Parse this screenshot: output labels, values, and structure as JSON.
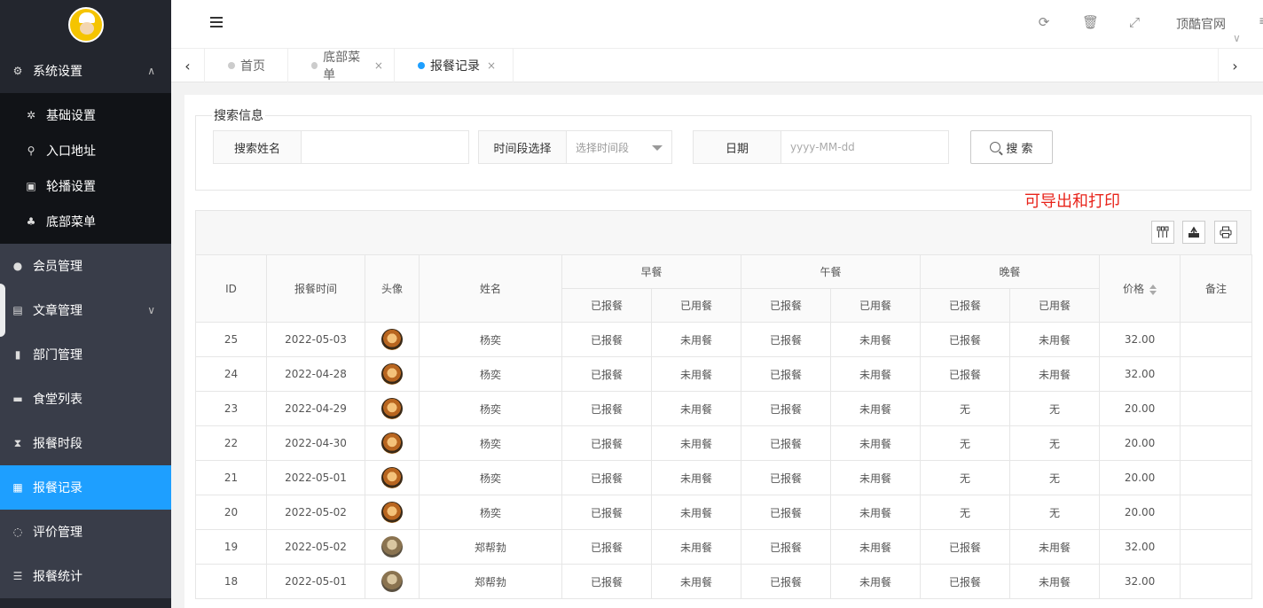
{
  "sidebar": {
    "groups": [
      {
        "label": "系统设置",
        "icon": "gears-icon",
        "arrow": "∧"
      },
      {
        "label": "会员管理",
        "icon": "user-icon"
      },
      {
        "label": "文章管理",
        "icon": "article-icon",
        "arrow": "∨"
      },
      {
        "label": "部门管理",
        "icon": "department-icon"
      },
      {
        "label": "食堂列表",
        "icon": "canteen-icon"
      },
      {
        "label": "报餐时段",
        "icon": "hourglass-icon"
      },
      {
        "label": "报餐记录",
        "icon": "table-icon"
      },
      {
        "label": "评价管理",
        "icon": "comment-icon"
      },
      {
        "label": "报餐统计",
        "icon": "stats-icon"
      }
    ],
    "sub_items": [
      {
        "label": "基础设置",
        "icon": "gear-icon"
      },
      {
        "label": "入口地址",
        "icon": "search-icon"
      },
      {
        "label": "轮播设置",
        "icon": "image-icon"
      },
      {
        "label": "底部菜单",
        "icon": "sitemap-icon"
      }
    ]
  },
  "header": {
    "link": "顶酷官网",
    "caret": "∨",
    "more": "≡",
    "icons": [
      "refresh-icon",
      "trash-icon",
      "fullscreen-icon"
    ]
  },
  "tabs": [
    {
      "label": "首页",
      "closable": false
    },
    {
      "label": "底部菜单",
      "closable": true
    },
    {
      "label": "报餐记录",
      "closable": true,
      "active": true
    }
  ],
  "tab_close": "×",
  "tab_prev": "‹",
  "tab_next": "›",
  "search": {
    "legend": "搜索信息",
    "name_label": "搜索姓名",
    "name_value": "",
    "period_label": "时间段选择",
    "period_placeholder": "选择时间段",
    "date_label": "日期",
    "date_placeholder": "yyyy-MM-dd",
    "button": "搜 索"
  },
  "annotation": "可导出和打印",
  "toolbar_icons": [
    "columns-icon",
    "export-icon",
    "print-icon"
  ],
  "table": {
    "headers": {
      "id": "ID",
      "time": "报餐时间",
      "avatar": "头像",
      "name": "姓名",
      "breakfast": "早餐",
      "lunch": "午餐",
      "dinner": "晚餐",
      "reported": "已报餐",
      "used": "已用餐",
      "price": "价格",
      "remark": "备注"
    },
    "rows": [
      {
        "id": "25",
        "time": "2022-05-03",
        "avatar": "tiger",
        "name": "杨奕",
        "b1": "已报餐",
        "b2": "未用餐",
        "l1": "已报餐",
        "l2": "未用餐",
        "d1": "已报餐",
        "d2": "未用餐",
        "price": "32.00",
        "remark": ""
      },
      {
        "id": "24",
        "time": "2022-04-28",
        "avatar": "tiger",
        "name": "杨奕",
        "b1": "已报餐",
        "b2": "未用餐",
        "l1": "已报餐",
        "l2": "未用餐",
        "d1": "已报餐",
        "d2": "未用餐",
        "price": "32.00",
        "remark": ""
      },
      {
        "id": "23",
        "time": "2022-04-29",
        "avatar": "tiger",
        "name": "杨奕",
        "b1": "已报餐",
        "b2": "未用餐",
        "l1": "已报餐",
        "l2": "未用餐",
        "d1": "无",
        "d2": "无",
        "price": "20.00",
        "remark": ""
      },
      {
        "id": "22",
        "time": "2022-04-30",
        "avatar": "tiger",
        "name": "杨奕",
        "b1": "已报餐",
        "b2": "未用餐",
        "l1": "已报餐",
        "l2": "未用餐",
        "d1": "无",
        "d2": "无",
        "price": "20.00",
        "remark": ""
      },
      {
        "id": "21",
        "time": "2022-05-01",
        "avatar": "tiger",
        "name": "杨奕",
        "b1": "已报餐",
        "b2": "未用餐",
        "l1": "已报餐",
        "l2": "未用餐",
        "d1": "无",
        "d2": "无",
        "price": "20.00",
        "remark": ""
      },
      {
        "id": "20",
        "time": "2022-05-02",
        "avatar": "tiger",
        "name": "杨奕",
        "b1": "已报餐",
        "b2": "未用餐",
        "l1": "已报餐",
        "l2": "未用餐",
        "d1": "无",
        "d2": "无",
        "price": "20.00",
        "remark": ""
      },
      {
        "id": "19",
        "time": "2022-05-02",
        "avatar": "dog",
        "name": "郑帮勃",
        "b1": "已报餐",
        "b2": "未用餐",
        "l1": "已报餐",
        "l2": "未用餐",
        "d1": "已报餐",
        "d2": "未用餐",
        "price": "32.00",
        "remark": ""
      },
      {
        "id": "18",
        "time": "2022-05-01",
        "avatar": "dog",
        "name": "郑帮勃",
        "b1": "已报餐",
        "b2": "未用餐",
        "l1": "已报餐",
        "l2": "未用餐",
        "d1": "已报餐",
        "d2": "未用餐",
        "price": "32.00",
        "remark": ""
      }
    ]
  },
  "colors": {
    "accent": "#1e9fff",
    "sidebar": "#393d49",
    "reported": "#0e8a0e",
    "unused": "#e02020",
    "annotation": "#e8241b"
  }
}
